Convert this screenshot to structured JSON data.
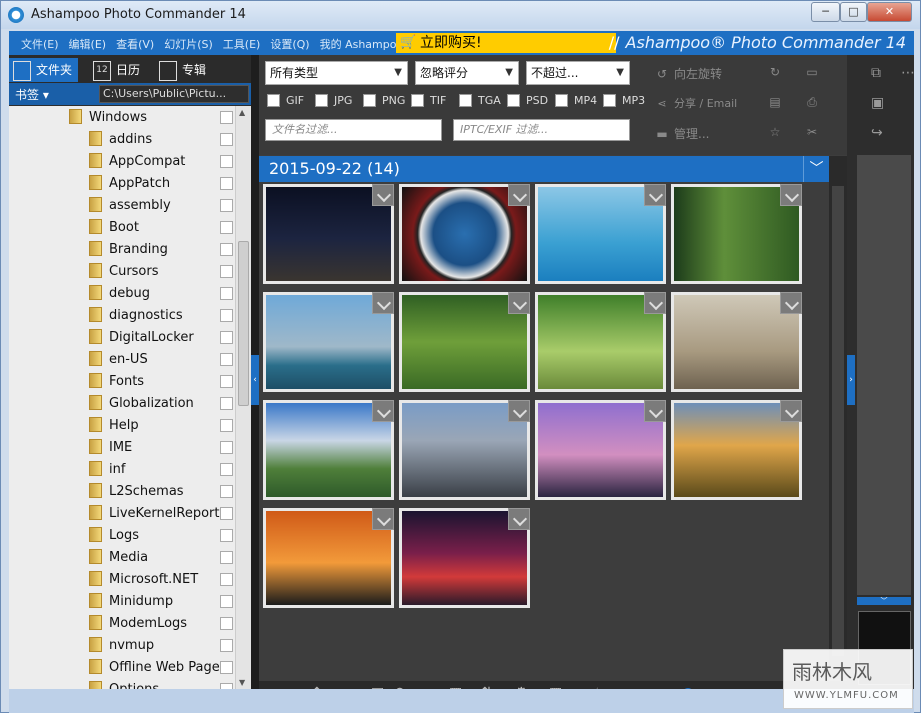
{
  "window": {
    "title": "Ashampoo Photo Commander 14",
    "min": "─",
    "max": "□",
    "close": "✕"
  },
  "menu": {
    "items": [
      "文件(E)",
      "编辑(E)",
      "查看(V)",
      "幻灯片(S)",
      "工具(E)",
      "设置(Q)",
      "我的 Ashampoo"
    ],
    "buy_label": "立即购买!",
    "brand_slash": "//",
    "brand": "Ashampoo® Photo Commander 14"
  },
  "left": {
    "tabs": [
      {
        "label": "文件夹",
        "icon": "folder-icon"
      },
      {
        "label": "日历",
        "icon": "calendar-icon",
        "icon_text": "12"
      },
      {
        "label": "专辑",
        "icon": "album-icon"
      }
    ],
    "bookmarks_label": "书签 ▾",
    "path": "C:\\Users\\Public\\Pictu...",
    "tree": [
      "Windows",
      "addins",
      "AppCompat",
      "AppPatch",
      "assembly",
      "Boot",
      "Branding",
      "Cursors",
      "debug",
      "diagnostics",
      "DigitalLocker",
      "en-US",
      "Fonts",
      "Globalization",
      "Help",
      "IME",
      "inf",
      "L2Schemas",
      "LiveKernelReports",
      "Logs",
      "Media",
      "Microsoft.NET",
      "Minidump",
      "ModemLogs",
      "nvmup",
      "Offline Web Pages",
      "Options"
    ]
  },
  "filters": {
    "type_select": "所有类型",
    "rating_select": "忽略评分",
    "size_select": "不超过...",
    "filetypes": [
      "GIF",
      "JPG",
      "PNG",
      "TIF",
      "TGA",
      "PSD",
      "MP4",
      "MP3"
    ],
    "filename_placeholder": "文件名过滤...",
    "exif_placeholder": "IPTC/EXIF 过滤..."
  },
  "actions": {
    "rotate_left": "向左旋转",
    "share": "分享 / Email",
    "manage": "管理..."
  },
  "gallery": {
    "date_header": "2015-09-22 (14)",
    "photos": [
      {
        "name": "city-night-pier"
      },
      {
        "name": "porthole-sea"
      },
      {
        "name": "dolphin"
      },
      {
        "name": "lizard-branch"
      },
      {
        "name": "dubai-skyline"
      },
      {
        "name": "forest-tree"
      },
      {
        "name": "tree-alley-bench"
      },
      {
        "name": "goats"
      },
      {
        "name": "mountain-lake"
      },
      {
        "name": "city-aerial-empire"
      },
      {
        "name": "purple-skyline"
      },
      {
        "name": "sunflowers-windmills"
      },
      {
        "name": "palm-sunset"
      },
      {
        "name": "times-square"
      }
    ]
  },
  "watermark": {
    "main": "雨林木风",
    "url": "WWW.YLMFU.COM"
  }
}
